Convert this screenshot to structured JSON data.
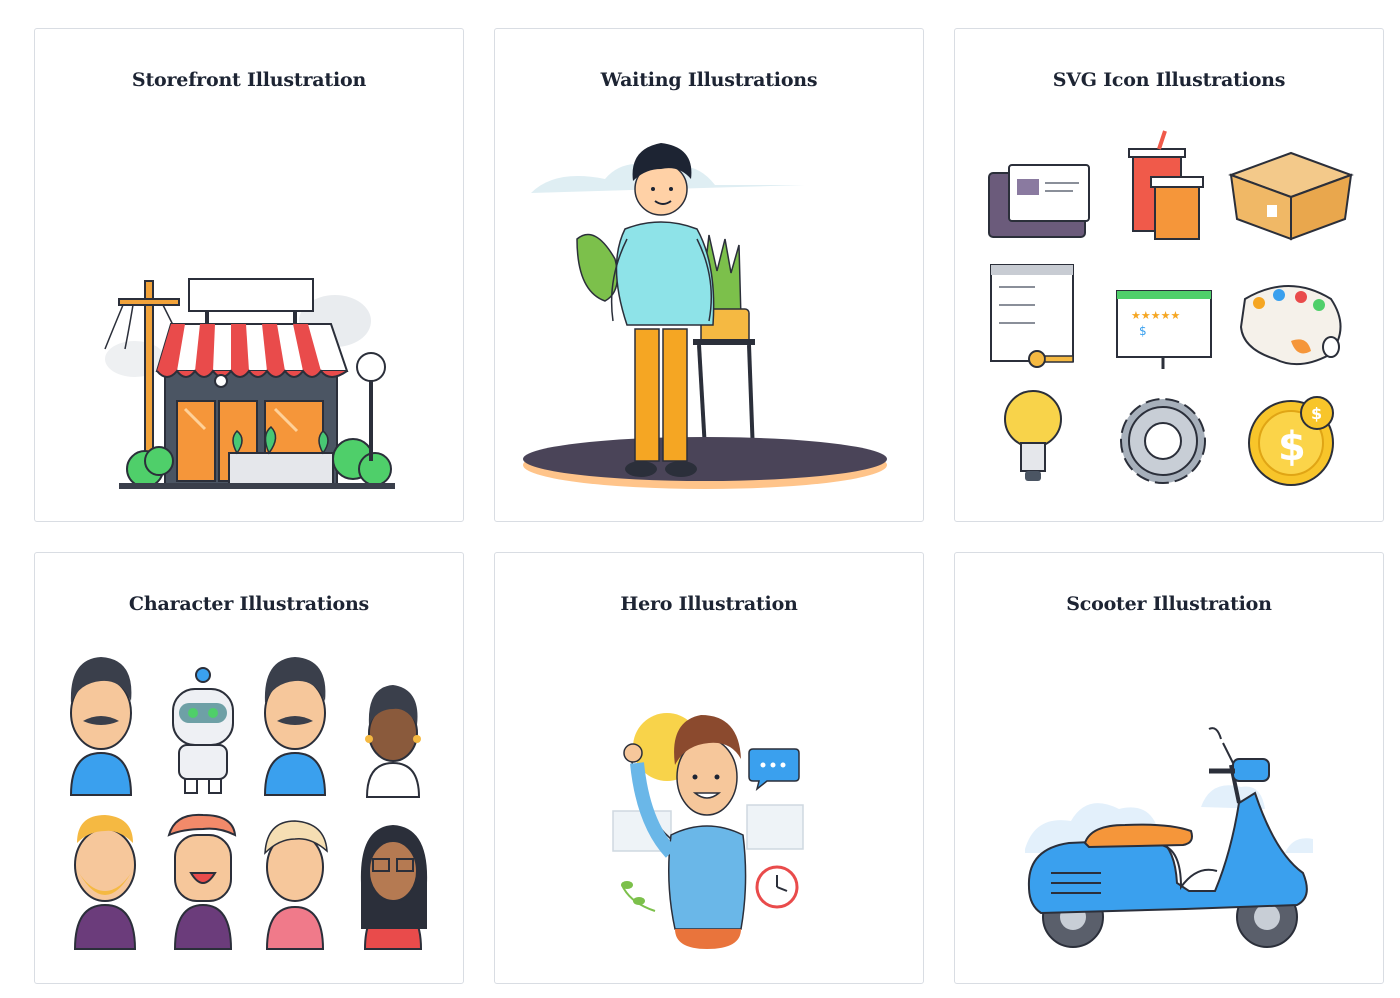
{
  "cards": [
    {
      "title": "Storefront Illustration",
      "art": "storefront-illustration"
    },
    {
      "title": "Waiting Illustrations",
      "art": "waiting-person-illustration"
    },
    {
      "title": "SVG Icon Illustrations",
      "art": "svg-icon-set-illustration"
    },
    {
      "title": "Character Illustrations",
      "art": "character-avatars-illustration"
    },
    {
      "title": "Hero Illustration",
      "art": "hero-waving-person-illustration"
    },
    {
      "title": "Scooter Illustration",
      "art": "scooter-illustration"
    }
  ],
  "colors": {
    "title_text": "#1d2433",
    "card_border": "#d9dde3",
    "accent_red": "#e94b4b",
    "accent_orange": "#f5a623",
    "accent_blue": "#3aa0ee",
    "accent_green": "#4fcf6a"
  }
}
